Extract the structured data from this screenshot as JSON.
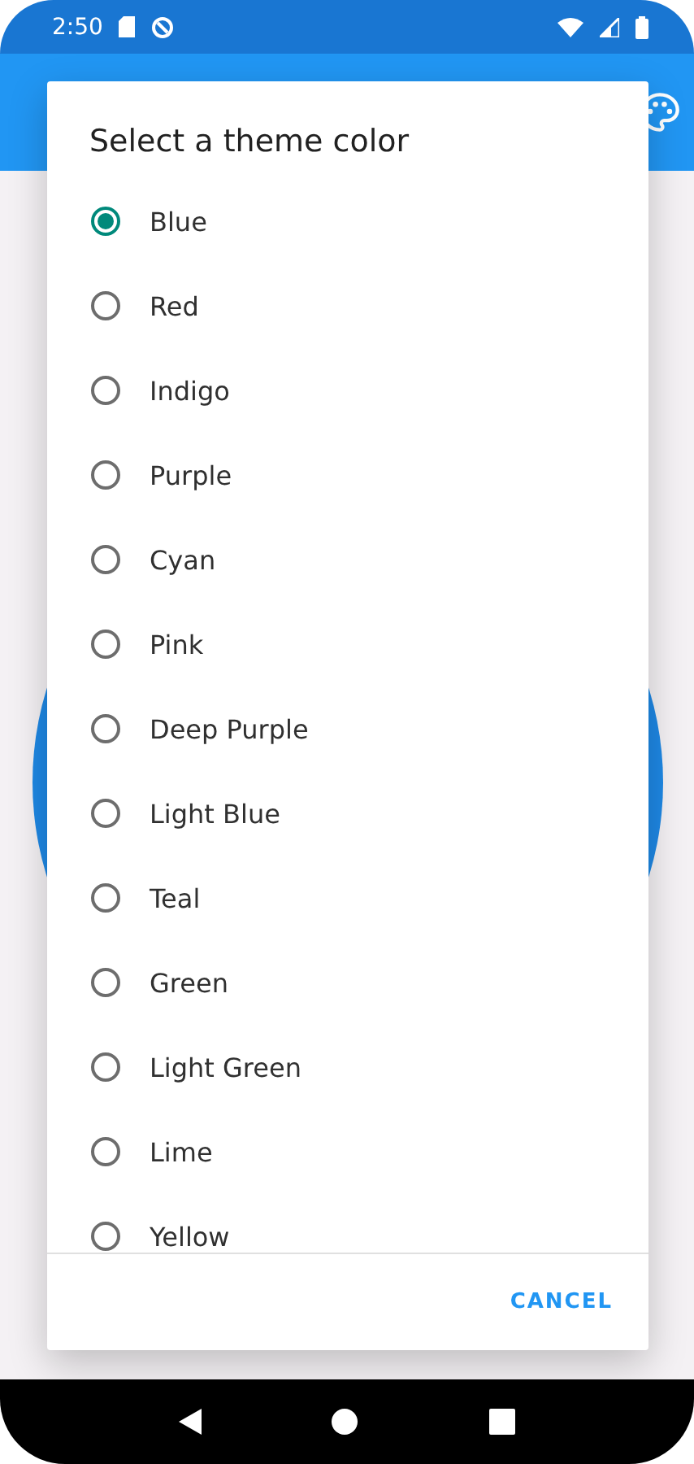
{
  "status_bar": {
    "time": "2:50"
  },
  "dialog": {
    "title": "Select a theme color",
    "options": [
      {
        "label": "Blue",
        "selected": true
      },
      {
        "label": "Red",
        "selected": false
      },
      {
        "label": "Indigo",
        "selected": false
      },
      {
        "label": "Purple",
        "selected": false
      },
      {
        "label": "Cyan",
        "selected": false
      },
      {
        "label": "Pink",
        "selected": false
      },
      {
        "label": "Deep Purple",
        "selected": false
      },
      {
        "label": "Light Blue",
        "selected": false
      },
      {
        "label": "Teal",
        "selected": false
      },
      {
        "label": "Green",
        "selected": false
      },
      {
        "label": "Light Green",
        "selected": false
      },
      {
        "label": "Lime",
        "selected": false
      },
      {
        "label": "Yellow",
        "selected": false
      }
    ],
    "buttons": [
      "CANCEL"
    ]
  }
}
